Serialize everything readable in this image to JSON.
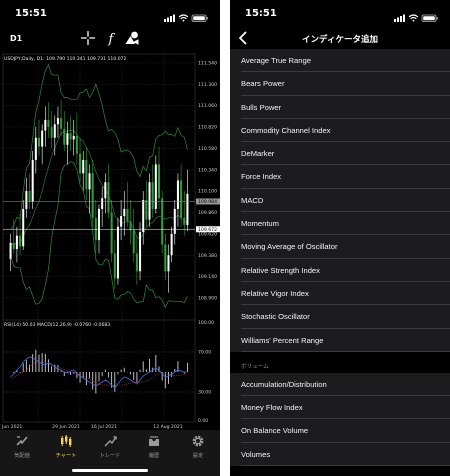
{
  "left": {
    "status": {
      "time": "15:51"
    },
    "timeframe": "D1",
    "icons": {
      "crosshair": "crosshair-icon",
      "indicator": "function-icon",
      "objects": "shapes-icon"
    },
    "chart_data": [
      {
        "type": "candlestick",
        "title": "USDJPY,Daily, D1: 109.790 110.341 109.731 110.072",
        "symbol": "USDJPY,Daily",
        "timeframe": "D1",
        "ohlc_label": "109.790 110.341 109.731 110.072",
        "ylim": [
          108.72,
          111.64
        ],
        "y_ticks": [
          "111.540",
          "111.300",
          "111.060",
          "110.820",
          "110.580",
          "110.340",
          "110.100",
          "109.860",
          "109.620",
          "109.380",
          "109.140",
          "108.900"
        ],
        "price_line": "109.984",
        "bid_line": "109.672",
        "x_ticks": [
          "7 Jun 2021",
          "29 Jun 2021",
          "16 Jul 2021",
          "12 Aug 2021"
        ],
        "candles": [
          {
            "o": 109.34,
            "h": 109.62,
            "l": 109.2,
            "c": 109.52
          },
          {
            "o": 109.52,
            "h": 109.78,
            "l": 109.4,
            "c": 109.45
          },
          {
            "o": 109.45,
            "h": 109.7,
            "l": 109.3,
            "c": 109.6
          },
          {
            "o": 109.6,
            "h": 109.84,
            "l": 109.38,
            "c": 109.48
          },
          {
            "o": 109.48,
            "h": 110.0,
            "l": 109.44,
            "c": 109.9
          },
          {
            "o": 109.9,
            "h": 110.25,
            "l": 109.8,
            "c": 110.1
          },
          {
            "o": 110.1,
            "h": 110.3,
            "l": 109.9,
            "c": 109.98
          },
          {
            "o": 109.98,
            "h": 110.55,
            "l": 109.9,
            "c": 110.45
          },
          {
            "o": 110.45,
            "h": 110.82,
            "l": 110.3,
            "c": 110.7
          },
          {
            "o": 110.7,
            "h": 110.9,
            "l": 110.5,
            "c": 110.6
          },
          {
            "o": 110.6,
            "h": 110.85,
            "l": 110.4,
            "c": 110.78
          },
          {
            "o": 110.78,
            "h": 111.05,
            "l": 110.6,
            "c": 110.9
          },
          {
            "o": 110.9,
            "h": 111.1,
            "l": 110.7,
            "c": 110.82
          },
          {
            "o": 110.82,
            "h": 111.0,
            "l": 110.58,
            "c": 110.7
          },
          {
            "o": 110.7,
            "h": 110.95,
            "l": 110.5,
            "c": 110.85
          },
          {
            "o": 110.85,
            "h": 111.05,
            "l": 110.7,
            "c": 110.92
          },
          {
            "o": 110.92,
            "h": 111.12,
            "l": 110.72,
            "c": 110.8
          },
          {
            "o": 110.8,
            "h": 111.0,
            "l": 110.55,
            "c": 110.62
          },
          {
            "o": 110.62,
            "h": 110.88,
            "l": 110.4,
            "c": 110.75
          },
          {
            "o": 110.75,
            "h": 110.95,
            "l": 110.55,
            "c": 110.68
          },
          {
            "o": 110.68,
            "h": 110.9,
            "l": 110.5,
            "c": 110.72
          },
          {
            "o": 110.72,
            "h": 110.98,
            "l": 110.4,
            "c": 110.52
          },
          {
            "o": 110.52,
            "h": 110.7,
            "l": 110.2,
            "c": 110.3
          },
          {
            "o": 110.3,
            "h": 110.55,
            "l": 110.1,
            "c": 110.45
          },
          {
            "o": 110.45,
            "h": 110.6,
            "l": 110.0,
            "c": 110.12
          },
          {
            "o": 110.12,
            "h": 110.4,
            "l": 109.85,
            "c": 110.3
          },
          {
            "o": 110.3,
            "h": 110.45,
            "l": 109.7,
            "c": 109.8
          },
          {
            "o": 109.8,
            "h": 110.0,
            "l": 109.4,
            "c": 109.55
          },
          {
            "o": 109.55,
            "h": 109.95,
            "l": 109.4,
            "c": 109.9
          },
          {
            "o": 109.9,
            "h": 110.15,
            "l": 109.7,
            "c": 110.02
          },
          {
            "o": 110.02,
            "h": 110.3,
            "l": 109.85,
            "c": 110.2
          },
          {
            "o": 110.2,
            "h": 110.4,
            "l": 109.8,
            "c": 109.86
          },
          {
            "o": 109.86,
            "h": 110.0,
            "l": 109.3,
            "c": 109.4
          },
          {
            "o": 109.4,
            "h": 109.55,
            "l": 109.0,
            "c": 109.12
          },
          {
            "o": 109.12,
            "h": 109.8,
            "l": 109.05,
            "c": 109.7
          },
          {
            "o": 109.7,
            "h": 110.0,
            "l": 109.55,
            "c": 109.82
          },
          {
            "o": 109.82,
            "h": 110.1,
            "l": 109.6,
            "c": 109.9
          },
          {
            "o": 109.9,
            "h": 110.2,
            "l": 109.7,
            "c": 109.76
          },
          {
            "o": 109.76,
            "h": 110.0,
            "l": 109.5,
            "c": 109.66
          },
          {
            "o": 109.66,
            "h": 109.9,
            "l": 109.3,
            "c": 109.4
          },
          {
            "o": 109.4,
            "h": 109.6,
            "l": 109.05,
            "c": 109.2
          },
          {
            "o": 109.2,
            "h": 109.75,
            "l": 109.1,
            "c": 109.64
          },
          {
            "o": 109.64,
            "h": 110.1,
            "l": 109.5,
            "c": 110.0
          },
          {
            "o": 110.0,
            "h": 110.22,
            "l": 109.7,
            "c": 109.78
          },
          {
            "o": 109.78,
            "h": 110.3,
            "l": 109.7,
            "c": 110.2
          },
          {
            "o": 110.2,
            "h": 110.4,
            "l": 109.8,
            "c": 109.9
          },
          {
            "o": 109.9,
            "h": 110.5,
            "l": 109.85,
            "c": 110.4
          },
          {
            "o": 110.4,
            "h": 110.6,
            "l": 109.9,
            "c": 110.02
          },
          {
            "o": 110.02,
            "h": 110.1,
            "l": 109.4,
            "c": 109.5
          },
          {
            "o": 109.5,
            "h": 109.62,
            "l": 109.1,
            "c": 109.2
          },
          {
            "o": 109.2,
            "h": 109.5,
            "l": 108.96,
            "c": 109.38
          },
          {
            "o": 109.38,
            "h": 109.7,
            "l": 109.3,
            "c": 109.62
          },
          {
            "o": 109.62,
            "h": 110.0,
            "l": 109.5,
            "c": 109.9
          },
          {
            "o": 109.9,
            "h": 110.3,
            "l": 109.7,
            "c": 110.22
          },
          {
            "o": 110.22,
            "h": 110.4,
            "l": 109.7,
            "c": 109.8
          },
          {
            "o": 109.8,
            "h": 110.1,
            "l": 109.6,
            "c": 109.72
          },
          {
            "o": 109.72,
            "h": 110.34,
            "l": 109.65,
            "c": 110.07
          }
        ]
      },
      {
        "type": "line",
        "title": "RSI(14) 50.03 MACD(12,26,9) -0.0760 -0.0683",
        "ylim": [
          0,
          100
        ],
        "y_ticks": [
          "100.00",
          "70.00",
          "30.00",
          "0.00"
        ],
        "series": [
          {
            "name": "RSI(14)",
            "last": "50.03",
            "values": [
              45,
              48,
              52,
              55,
              60,
              63,
              65,
              64,
              62,
              60,
              58,
              57,
              59,
              58,
              55,
              53,
              52,
              50,
              49,
              51,
              52,
              48,
              46,
              44,
              42,
              40,
              38,
              36,
              38,
              40,
              42,
              40,
              37,
              34,
              38,
              42,
              45,
              44,
              42,
              40,
              38,
              42,
              46,
              48,
              50,
              52,
              54,
              52,
              48,
              45,
              46,
              48,
              50,
              52,
              51,
              50,
              50
            ]
          }
        ],
        "macd": {
          "label": "MACD(12,26,9)",
          "main": "-0.0760",
          "signal": "-0.0683"
        }
      }
    ],
    "tabs": [
      {
        "label": "気配値",
        "icon": "quotes-icon"
      },
      {
        "label": "チャート",
        "icon": "chart-icon"
      },
      {
        "label": "トレード",
        "icon": "trade-icon"
      },
      {
        "label": "履歴",
        "icon": "history-icon"
      },
      {
        "label": "設定",
        "icon": "settings-icon"
      }
    ]
  },
  "right": {
    "status": {
      "time": "15:51"
    },
    "title": "インディケータ追加",
    "items": [
      "Average True Range",
      "Bears Power",
      "Bulls Power",
      "Commodity Channel Index",
      "DeMarker",
      "Force Index",
      "MACD",
      "Momentum",
      "Moving Average of Oscillator",
      "Relative Strength Index",
      "Relative Vigor Index",
      "Stochastic Oscillator",
      "Williams' Percent Range"
    ],
    "section": "ボリューム",
    "volume_items": [
      "Accumulation/Distribution",
      "Money Flow Index",
      "On Balance Volume",
      "Volumes"
    ]
  },
  "colors": {
    "background": "#000000",
    "cell": "#1c1c1e",
    "separator": "#3a3a3c",
    "bull_candle": "#ffffff",
    "bear_candle": "#2e9e3a",
    "bands": "#2e8b3a",
    "active_tab": "#ffd54a",
    "rsi_line": "#3d6ee8",
    "macd_signal": "#b04040"
  }
}
